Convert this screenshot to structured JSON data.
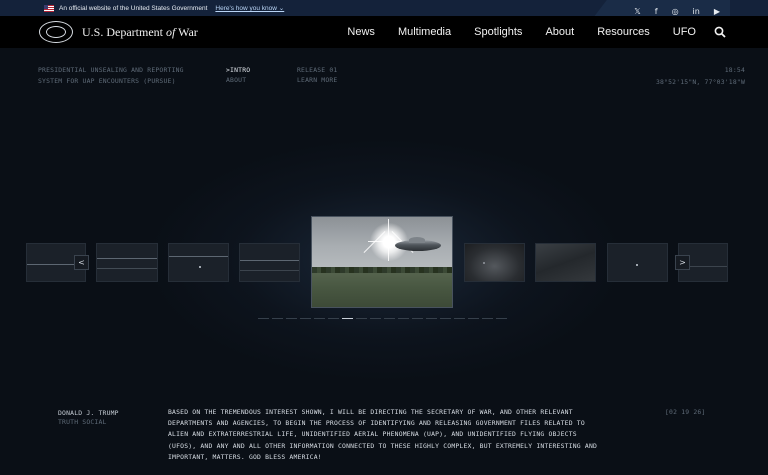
{
  "gov_banner": {
    "text": "An official website of the United States Government",
    "link": "Here's how you know"
  },
  "social": [
    "𝕏",
    "f",
    "◎",
    "in",
    "▶"
  ],
  "header": {
    "brand_prefix": "U.S. Department ",
    "brand_of": "of",
    "brand_suffix": " War",
    "nav": [
      "News",
      "Multimedia",
      "Spotlights",
      "About",
      "Resources",
      "UFO"
    ]
  },
  "info": {
    "system_title": "PRESIDENTIAL UNSEALING AND REPORTING SYSTEM FOR UAP ENCOUNTERS (PURSUE)",
    "nav_intro": ">INTRO",
    "nav_about": "ABOUT",
    "release": "RELEASE 01",
    "learn_more": "LEARN MORE",
    "time": "18:54",
    "coords": "38°52'15\"N, 77°03'18\"W"
  },
  "carousel": {
    "prev": "<",
    "next": ">",
    "slide_count": 18,
    "active_index": 6
  },
  "quote": {
    "author": "DONALD J. TRUMP",
    "source": "TRUTH SOCIAL",
    "text": "BASED ON THE TREMENDOUS INTEREST SHOWN, I WILL BE DIRECTING THE SECRETARY OF WAR, AND OTHER RELEVANT DEPARTMENTS AND AGENCIES, TO BEGIN THE PROCESS OF IDENTIFYING AND RELEASING GOVERNMENT FILES RELATED TO ALIEN AND EXTRATERRESTRIAL LIFE, UNIDENTIFIED AERIAL PHENOMENA (UAP), AND UNIDENTIFIED FLYING OBJECTS (UFOS), AND ANY AND ALL OTHER INFORMATION CONNECTED TO THESE HIGHLY COMPLEX, BUT EXTREMELY INTERESTING AND IMPORTANT, MATTERS. GOD BLESS AMERICA!",
    "date": "[02 19 26]"
  }
}
